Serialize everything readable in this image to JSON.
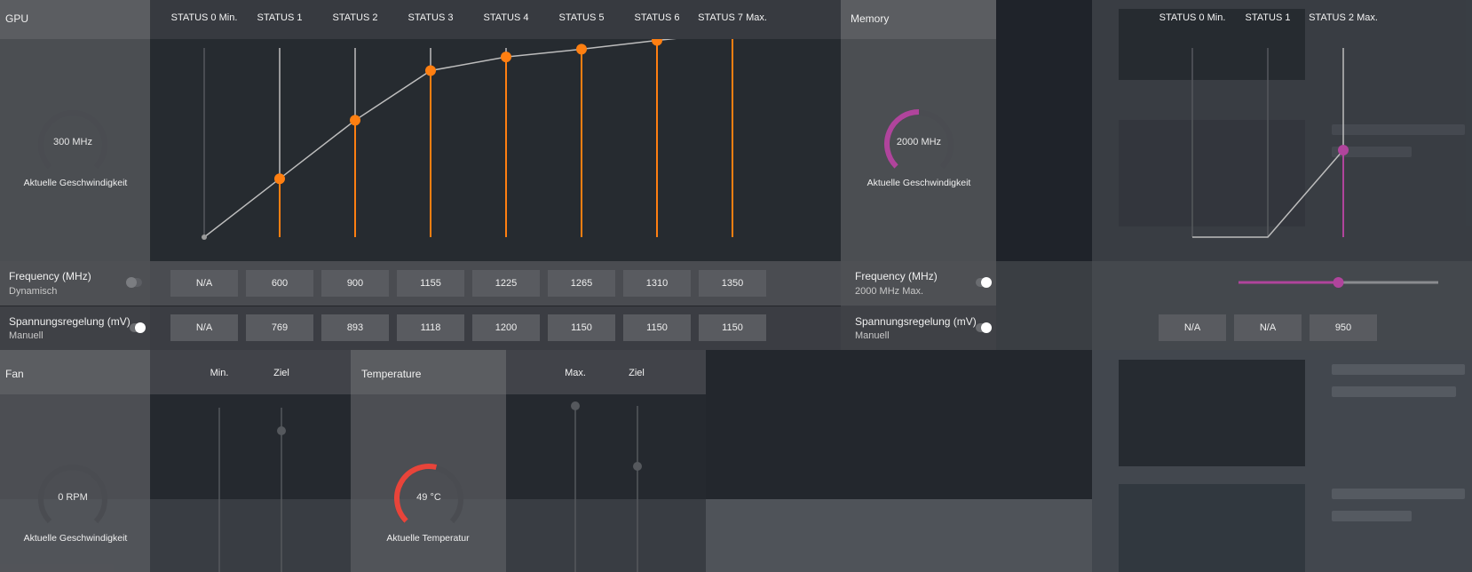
{
  "gpu": {
    "title": "GPU",
    "gauge": {
      "value": "300 MHz",
      "caption": "Aktuelle Geschwindigkeit",
      "level": 0
    },
    "states": [
      "STATUS 0 Min.",
      "STATUS 1",
      "STATUS 2",
      "STATUS 3",
      "STATUS 4",
      "STATUS 5",
      "STATUS 6",
      "STATUS 7 Max."
    ],
    "frequency": {
      "label": "Frequency (MHz)",
      "sub": "Dynamisch",
      "values": [
        "N/A",
        "600",
        "900",
        "1155",
        "1225",
        "1265",
        "1310",
        "1350"
      ]
    },
    "voltage": {
      "label": "Spannungsregelung (mV)",
      "sub": "Manuell",
      "values": [
        "N/A",
        "769",
        "893",
        "1118",
        "1200",
        "1150",
        "1150",
        "1150"
      ]
    },
    "accent": "#ff7f11"
  },
  "memory": {
    "title": "Memory",
    "gauge": {
      "value": "2000 MHz",
      "caption": "Aktuelle Geschwindigkeit",
      "level": 0.5
    },
    "states": [
      "STATUS 0 Min.",
      "STATUS 1",
      "STATUS 2 Max."
    ],
    "frequency": {
      "label": "Frequency (MHz)",
      "sub": "2000 MHz Max.",
      "slider_level": 0.5
    },
    "voltage": {
      "label": "Spannungsregelung (mV)",
      "sub": "Manuell",
      "values": [
        "N/A",
        "N/A",
        "950"
      ]
    },
    "accent": "#b0449c"
  },
  "fan": {
    "title": "Fan",
    "cols": [
      "Min.",
      "Ziel"
    ],
    "gauge": {
      "value": "0 RPM",
      "caption": "Aktuelle Geschwindigkeit",
      "level": 0
    }
  },
  "temperature": {
    "title": "Temperature",
    "cols": [
      "Max.",
      "Ziel"
    ],
    "gauge": {
      "value": "49 °C",
      "caption": "Aktuelle Temperatur",
      "level": 0.55
    },
    "accent": "#e8443a"
  },
  "chart_data": [
    {
      "type": "line",
      "title": "",
      "categories": [
        "STATUS 0 Min.",
        "STATUS 1",
        "STATUS 2",
        "STATUS 3",
        "STATUS 4",
        "STATUS 5",
        "STATUS 6",
        "STATUS 7 Max."
      ],
      "series": [
        {
          "values": [
            null,
            600,
            900,
            1155,
            1225,
            1265,
            1310,
            1350
          ]
        }
      ]
    }
  ]
}
